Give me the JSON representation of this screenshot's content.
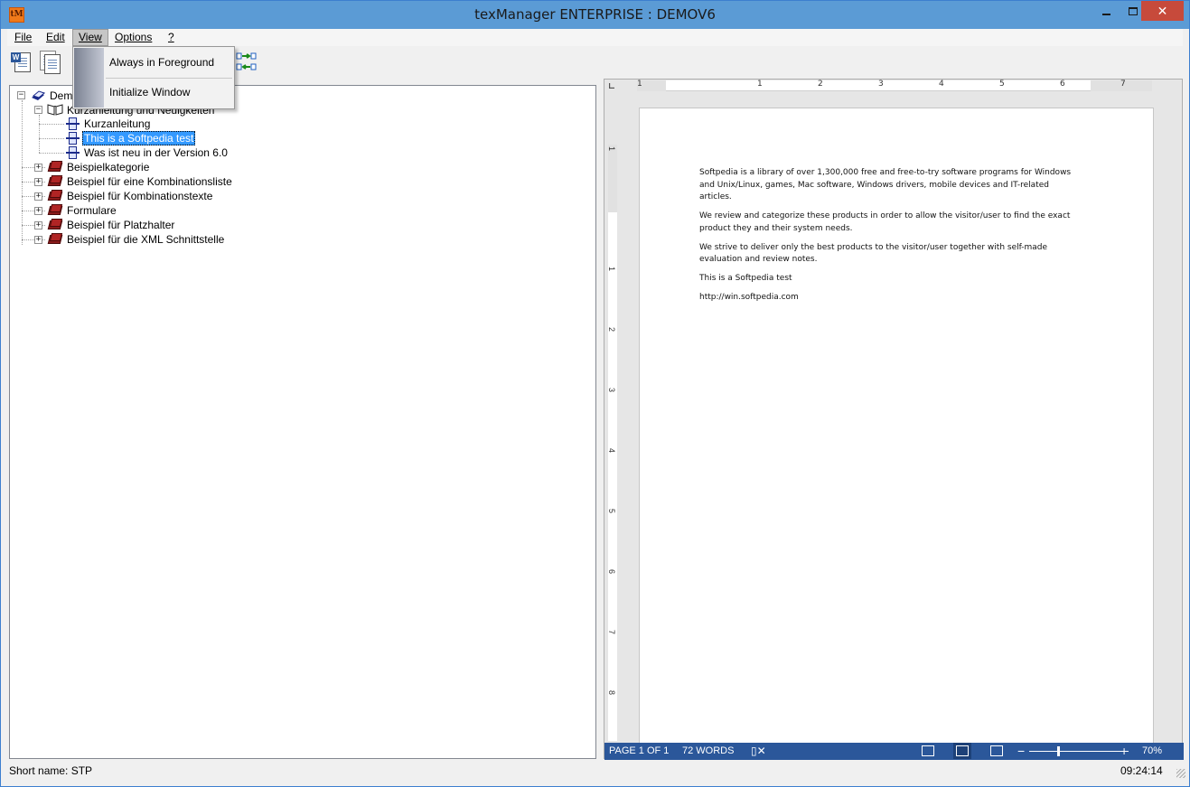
{
  "window": {
    "title": "texManager ENTERPRISE : DEMOV6",
    "app_icon_text": "tM",
    "close_glyph": "✕"
  },
  "menubar": {
    "items": [
      {
        "label": "File",
        "key": "F"
      },
      {
        "label": "Edit",
        "key": "E"
      },
      {
        "label": "View",
        "key": "V"
      },
      {
        "label": "Options",
        "key": "O"
      },
      {
        "label": "?",
        "key": "?"
      }
    ]
  },
  "view_menu": {
    "items": [
      {
        "label": "Always in Foreground"
      },
      {
        "label": "Initialize Window"
      }
    ]
  },
  "tree": {
    "root": "Demo",
    "group": "Kurzanleitung und Neuigkeiten",
    "children": [
      "Kurzanleitung",
      "This is a Softpedia test",
      "Was ist neu in der Version 6.0"
    ],
    "selected": "This is a Softpedia test",
    "categories": [
      "Beispielkategorie",
      "Beispiel für eine Kombinationsliste",
      "Beispiel für Kombinationstexte",
      "Formulare",
      "Beispiel für Platzhalter",
      "Beispiel für die XML Schnittstelle"
    ]
  },
  "ruler": {
    "h_numbers": [
      "1",
      "1",
      "2",
      "3",
      "4",
      "5",
      "6",
      "7"
    ],
    "v_numbers": [
      "1",
      "1",
      "2",
      "3",
      "4",
      "5",
      "6",
      "7",
      "8"
    ]
  },
  "document": {
    "paragraphs": [
      "Softpedia is a library of over 1,300,000 free and free-to-try software programs for Windows and Unix/Linux, games, Mac software, Windows drivers, mobile devices and IT-related articles.",
      "We review and categorize these products in order to allow the visitor/user to find the exact product they and their system needs.",
      "We strive to deliver only the best products to the visitor/user together with self-made evaluation and review notes.",
      "This is a Softpedia test",
      "http://win.softpedia.com"
    ]
  },
  "word_status": {
    "page": "PAGE 1 OF 1",
    "words": "72 WORDS",
    "zoom": "70%",
    "zoom_minus": "−",
    "zoom_plus": "+"
  },
  "status": {
    "short_name": "Short name: STP",
    "time": "09:24:14"
  }
}
